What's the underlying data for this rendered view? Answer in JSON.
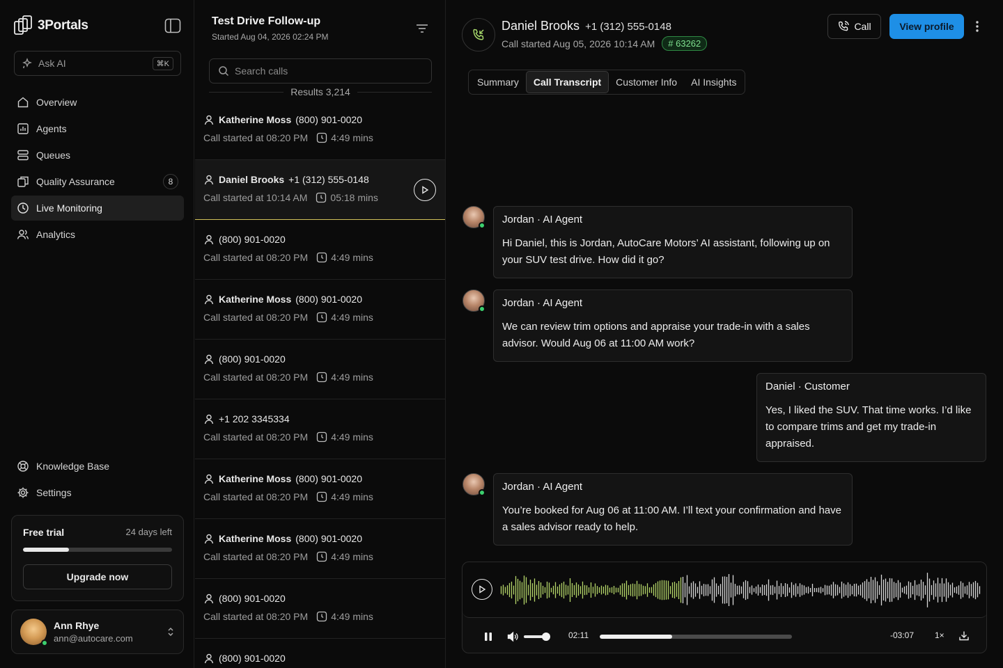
{
  "brand": {
    "name": "3Portals"
  },
  "ask_ai": {
    "label": "Ask AI",
    "shortcut": "⌘K"
  },
  "nav": [
    {
      "label": "Overview",
      "icon": "home-icon"
    },
    {
      "label": "Agents",
      "icon": "chart-icon"
    },
    {
      "label": "Queues",
      "icon": "stack-icon"
    },
    {
      "label": "Quality Assurance",
      "icon": "copy-icon",
      "badge": "8"
    },
    {
      "label": "Live Monitoring",
      "icon": "clock-icon",
      "active": true
    },
    {
      "label": "Analytics",
      "icon": "users-icon"
    }
  ],
  "nav_bottom": [
    {
      "label": "Knowledge Base",
      "icon": "lifebuoy-icon"
    },
    {
      "label": "Settings",
      "icon": "gear-icon"
    }
  ],
  "trial": {
    "label": "Free trial",
    "days_left": "24 days left",
    "progress": 0.31,
    "upgrade": "Upgrade now"
  },
  "user": {
    "name": "Ann Rhye",
    "email": "ann@autocare.com"
  },
  "call_list": {
    "title": "Test Drive Follow-up",
    "subtitle": "Started Aug 04, 2026 02:24 PM",
    "search_placeholder": "Search calls",
    "results": "Results 3,214",
    "rows": [
      {
        "name": "Katherine Moss",
        "phone": "(800) 901-0020",
        "started": "Call started at 08:20 PM",
        "duration": "4:49 mins"
      },
      {
        "name": "Daniel Brooks",
        "phone": "+1 (312) 555-0148",
        "started": "Call started at 10:14 AM",
        "duration": "05:18 mins",
        "selected": true
      },
      {
        "name": "",
        "phone": "(800) 901-0020",
        "started": "Call started at 08:20 PM",
        "duration": "4:49 mins"
      },
      {
        "name": "Katherine Moss",
        "phone": "(800) 901-0020",
        "started": "Call started at 08:20 PM",
        "duration": "4:49 mins"
      },
      {
        "name": "",
        "phone": "(800) 901-0020",
        "started": "Call started at 08:20 PM",
        "duration": "4:49 mins"
      },
      {
        "name": "",
        "phone": "+1 202 3345334",
        "started": "Call started at 08:20 PM",
        "duration": "4:49 mins"
      },
      {
        "name": "Katherine Moss",
        "phone": "(800) 901-0020",
        "started": "Call started at 08:20 PM",
        "duration": "4:49 mins"
      },
      {
        "name": "Katherine Moss",
        "phone": "(800) 901-0020",
        "started": "Call started at 08:20 PM",
        "duration": "4:49 mins"
      },
      {
        "name": "",
        "phone": "(800) 901-0020",
        "started": "Call started at 08:20 PM",
        "duration": "4:49 mins"
      },
      {
        "name": "",
        "phone": "(800) 901-0020",
        "started": "",
        "duration": ""
      }
    ]
  },
  "contact": {
    "name": "Daniel Brooks",
    "phone": "+1 (312) 555-0148",
    "started": "Call started Aug 05, 2026 10:14 AM",
    "id": "# 63262"
  },
  "actions": {
    "call": "Call",
    "view_profile": "View profile"
  },
  "tabs": [
    "Summary",
    "Call Transcript",
    "Customer Info",
    "AI Insights"
  ],
  "active_tab": "Call Transcript",
  "transcript": [
    {
      "speaker": "Jordan · AI Agent",
      "role": "agent",
      "text": "Hi Daniel, this is Jordan, AutoCare Motors’ AI assistant, following up on your SUV test drive. How did it go?"
    },
    {
      "speaker": "Jordan · AI Agent",
      "role": "agent",
      "text": "We can review trim options and appraise your trade-in with a sales advisor. Would Aug 06 at 11:00 AM work?"
    },
    {
      "speaker": "Daniel · Customer",
      "role": "customer",
      "text": "Yes, I liked the SUV. That time works. I’d like to compare trims and get my trade-in appraised."
    },
    {
      "speaker": "Jordan · AI Agent",
      "role": "agent",
      "text": "You’re booked for Aug 06 at 11:00 AM. I’ll text your confirmation and have a sales advisor ready to help."
    }
  ],
  "player": {
    "elapsed": "02:11",
    "remaining": "-03:07",
    "speed": "1×",
    "progress": 0.375,
    "volume": 0.8,
    "played_color": "#b6d66a",
    "unplayed_color": "#d8d8d8"
  }
}
